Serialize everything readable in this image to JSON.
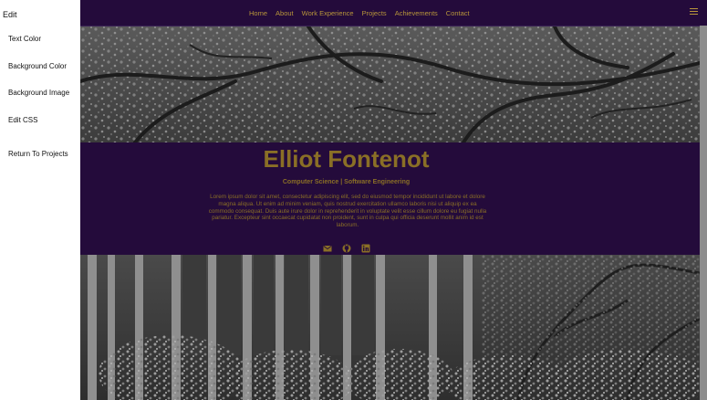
{
  "sidebar": {
    "title": "Edit",
    "items": [
      {
        "label": "Text Color"
      },
      {
        "label": "Background Color"
      },
      {
        "label": "Background Image"
      },
      {
        "label": "Edit CSS"
      },
      {
        "label": "Return To Projects"
      }
    ]
  },
  "nav": {
    "links": [
      "Home",
      "About",
      "Work Experience",
      "Projects",
      "Achievements",
      "Contact"
    ],
    "menu_icon": "hamburger-icon"
  },
  "intro": {
    "name": "Elliot Fontenot",
    "subtitle": "Computer Science | Software Engineering",
    "bio": "Lorem ipsum dolor sit amet, consectetur adipiscing elit, sed do eiusmod tempor incididunt ut labore et dolore magna aliqua. Ut enim ad minim veniam, quis nostrud exercitation ullamco laboris nisi ut aliquip ex ea commodo consequat. Duis aute irure dolor in reprehenderit in voluptate velit esse cillum dolore eu fugiat nulla pariatur. Excepteur sint occaecat cupidatat non proident, sunt in culpa qui officia deserunt mollit anim id est laborum.",
    "social_icons": [
      "email-icon",
      "github-icon",
      "linkedin-icon"
    ]
  },
  "colors": {
    "nav_bg": "#240b3b",
    "accent_gold": "#b8963b",
    "text_gold": "#8a6f26"
  }
}
